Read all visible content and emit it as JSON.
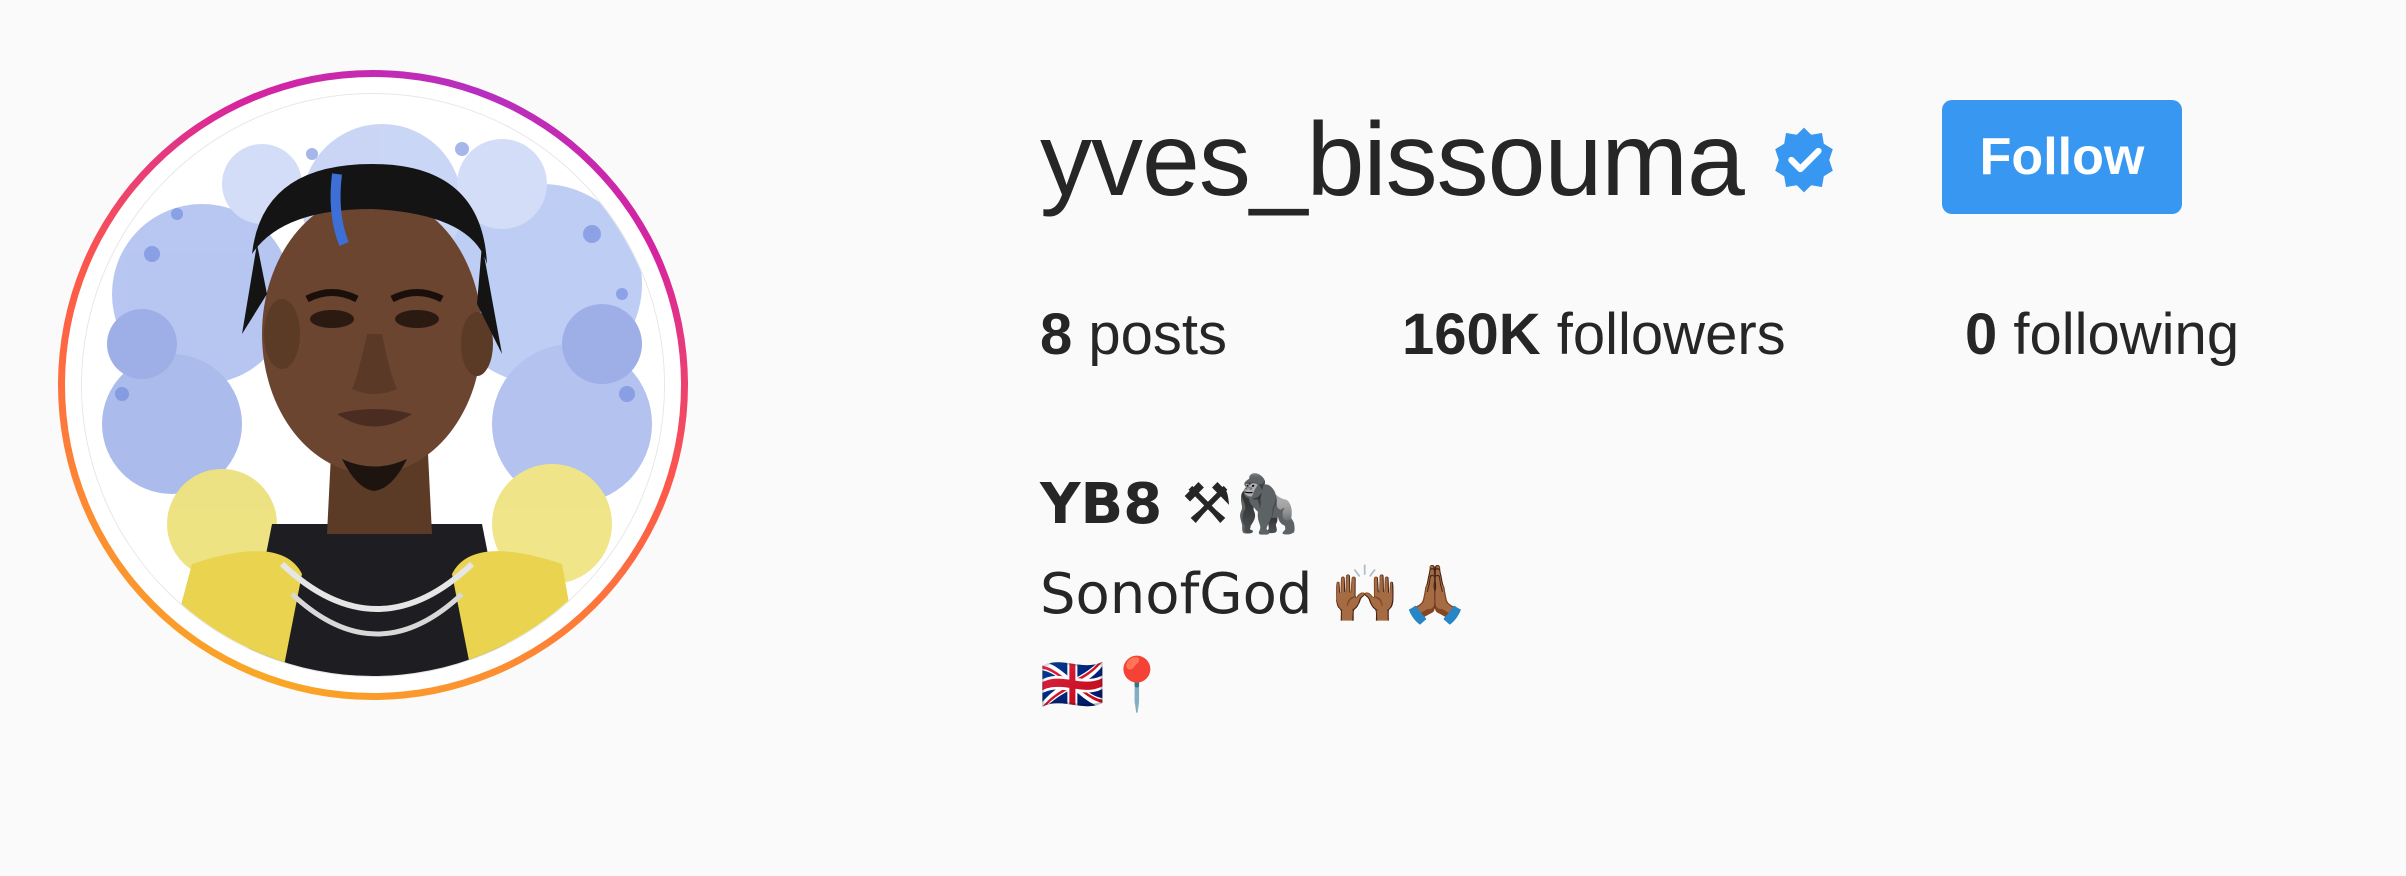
{
  "profile": {
    "username": "yves_bissouma",
    "verified_icon": "verified-badge-icon",
    "follow_label": "Follow",
    "accent_color": "#3897f0"
  },
  "stats": {
    "posts_count": "8",
    "posts_label": "posts",
    "followers_count": "160K",
    "followers_label": "followers",
    "following_count": "0",
    "following_label": "following"
  },
  "bio": {
    "name": "YB8 ⚒🦍",
    "line1": "SonofGod 🙌🏾🙏🏾",
    "line2": "🇬🇧📍"
  },
  "avatar": {
    "icon": "profile-avatar",
    "ring_colors": [
      "#f9a825",
      "#fd5949",
      "#d6249f"
    ]
  }
}
